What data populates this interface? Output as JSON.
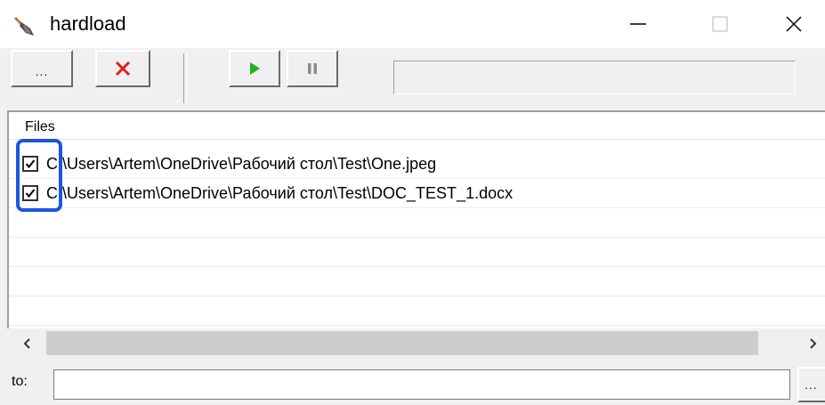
{
  "window": {
    "title": "hardload",
    "icon": "shovel-icon",
    "controls": [
      "minimize-icon",
      "maximize-icon",
      "close-icon"
    ]
  },
  "toolbar": {
    "browse_label": "...",
    "buttons": [
      "browse",
      "delete",
      "start",
      "pause"
    ],
    "icons": {
      "delete": "red-x-icon",
      "start": "green-play-icon",
      "pause": "pause-icon"
    },
    "colors": {
      "delete": "#e31b1b",
      "start": "#1db31d",
      "pause": "#8a8a8a"
    }
  },
  "files": {
    "column_header": "Files",
    "items": [
      {
        "checked": true,
        "path": "C:\\Users\\Artem\\OneDrive\\Рабочий стол\\Test\\One.jpeg"
      },
      {
        "checked": true,
        "path": "C:\\Users\\Artem\\OneDrive\\Рабочий стол\\Test\\DOC_TEST_1.docx"
      }
    ]
  },
  "destination": {
    "label": "to:",
    "value": "",
    "browse_label": "..."
  },
  "annotation": {
    "color": "#1a56e0"
  }
}
